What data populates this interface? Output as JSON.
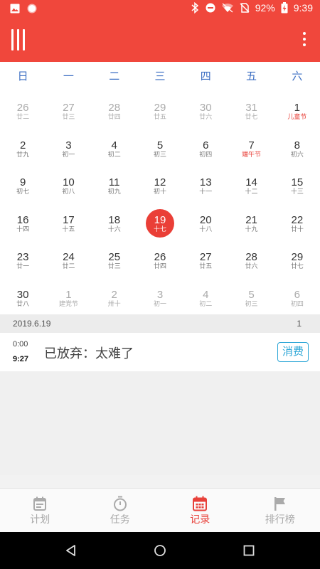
{
  "status_bar": {
    "battery": "92%",
    "time": "9:39",
    "icons": [
      "image-icon",
      "record-icon",
      "bluetooth-icon",
      "dnd-icon",
      "wifi-icon",
      "no-sim-icon",
      "battery-charging-icon"
    ]
  },
  "app_bar": {
    "menu_icon": "menu-bars-icon",
    "more_icon": "more-vertical-icon"
  },
  "calendar": {
    "weekdays": [
      "日",
      "一",
      "二",
      "三",
      "四",
      "五",
      "六"
    ],
    "weeks": [
      [
        {
          "day": "26",
          "lunar": "廿二",
          "dim": true
        },
        {
          "day": "27",
          "lunar": "廿三",
          "dim": true
        },
        {
          "day": "28",
          "lunar": "廿四",
          "dim": true
        },
        {
          "day": "29",
          "lunar": "廿五",
          "dim": true
        },
        {
          "day": "30",
          "lunar": "廿六",
          "dim": true
        },
        {
          "day": "31",
          "lunar": "廿七",
          "dim": true
        },
        {
          "day": "1",
          "lunar": "儿童节",
          "holiday": true
        }
      ],
      [
        {
          "day": "2",
          "lunar": "廿九"
        },
        {
          "day": "3",
          "lunar": "初一"
        },
        {
          "day": "4",
          "lunar": "初二"
        },
        {
          "day": "5",
          "lunar": "初三"
        },
        {
          "day": "6",
          "lunar": "初四"
        },
        {
          "day": "7",
          "lunar": "端午节",
          "holiday": true
        },
        {
          "day": "8",
          "lunar": "初六"
        }
      ],
      [
        {
          "day": "9",
          "lunar": "初七"
        },
        {
          "day": "10",
          "lunar": "初八"
        },
        {
          "day": "11",
          "lunar": "初九"
        },
        {
          "day": "12",
          "lunar": "初十"
        },
        {
          "day": "13",
          "lunar": "十一"
        },
        {
          "day": "14",
          "lunar": "十二"
        },
        {
          "day": "15",
          "lunar": "十三"
        }
      ],
      [
        {
          "day": "16",
          "lunar": "十四"
        },
        {
          "day": "17",
          "lunar": "十五"
        },
        {
          "day": "18",
          "lunar": "十六"
        },
        {
          "day": "19",
          "lunar": "十七",
          "selected": true
        },
        {
          "day": "20",
          "lunar": "十八"
        },
        {
          "day": "21",
          "lunar": "十九"
        },
        {
          "day": "22",
          "lunar": "廿十"
        }
      ],
      [
        {
          "day": "23",
          "lunar": "廿一"
        },
        {
          "day": "24",
          "lunar": "廿二"
        },
        {
          "day": "25",
          "lunar": "廿三"
        },
        {
          "day": "26",
          "lunar": "廿四"
        },
        {
          "day": "27",
          "lunar": "廿五"
        },
        {
          "day": "28",
          "lunar": "廿六"
        },
        {
          "day": "29",
          "lunar": "廿七"
        }
      ],
      [
        {
          "day": "30",
          "lunar": "廿八"
        },
        {
          "day": "1",
          "lunar": "建党节",
          "dim": true
        },
        {
          "day": "2",
          "lunar": "卅十",
          "dim": true
        },
        {
          "day": "3",
          "lunar": "初一",
          "dim": true
        },
        {
          "day": "4",
          "lunar": "初二",
          "dim": true
        },
        {
          "day": "5",
          "lunar": "初三",
          "dim": true
        },
        {
          "day": "6",
          "lunar": "初四",
          "dim": true
        }
      ]
    ]
  },
  "records_header": {
    "date": "2019.6.19",
    "count": "1"
  },
  "record": {
    "start": "0:00",
    "duration": "9:27",
    "title": "已放弃：太难了",
    "tag": "消费"
  },
  "bottom_nav": [
    {
      "label": "计划",
      "icon": "calendar-icon",
      "active": false
    },
    {
      "label": "任务",
      "icon": "stopwatch-icon",
      "active": false
    },
    {
      "label": "记录",
      "icon": "calendar-grid-icon",
      "active": true
    },
    {
      "label": "排行榜",
      "icon": "flag-icon",
      "active": false
    }
  ],
  "colors": {
    "primary": "#f0473c",
    "weekday_text": "#3d6fc3",
    "holiday_text": "#e8413a",
    "tag": "#2aa5d6",
    "inactive": "#aaaaaa"
  }
}
